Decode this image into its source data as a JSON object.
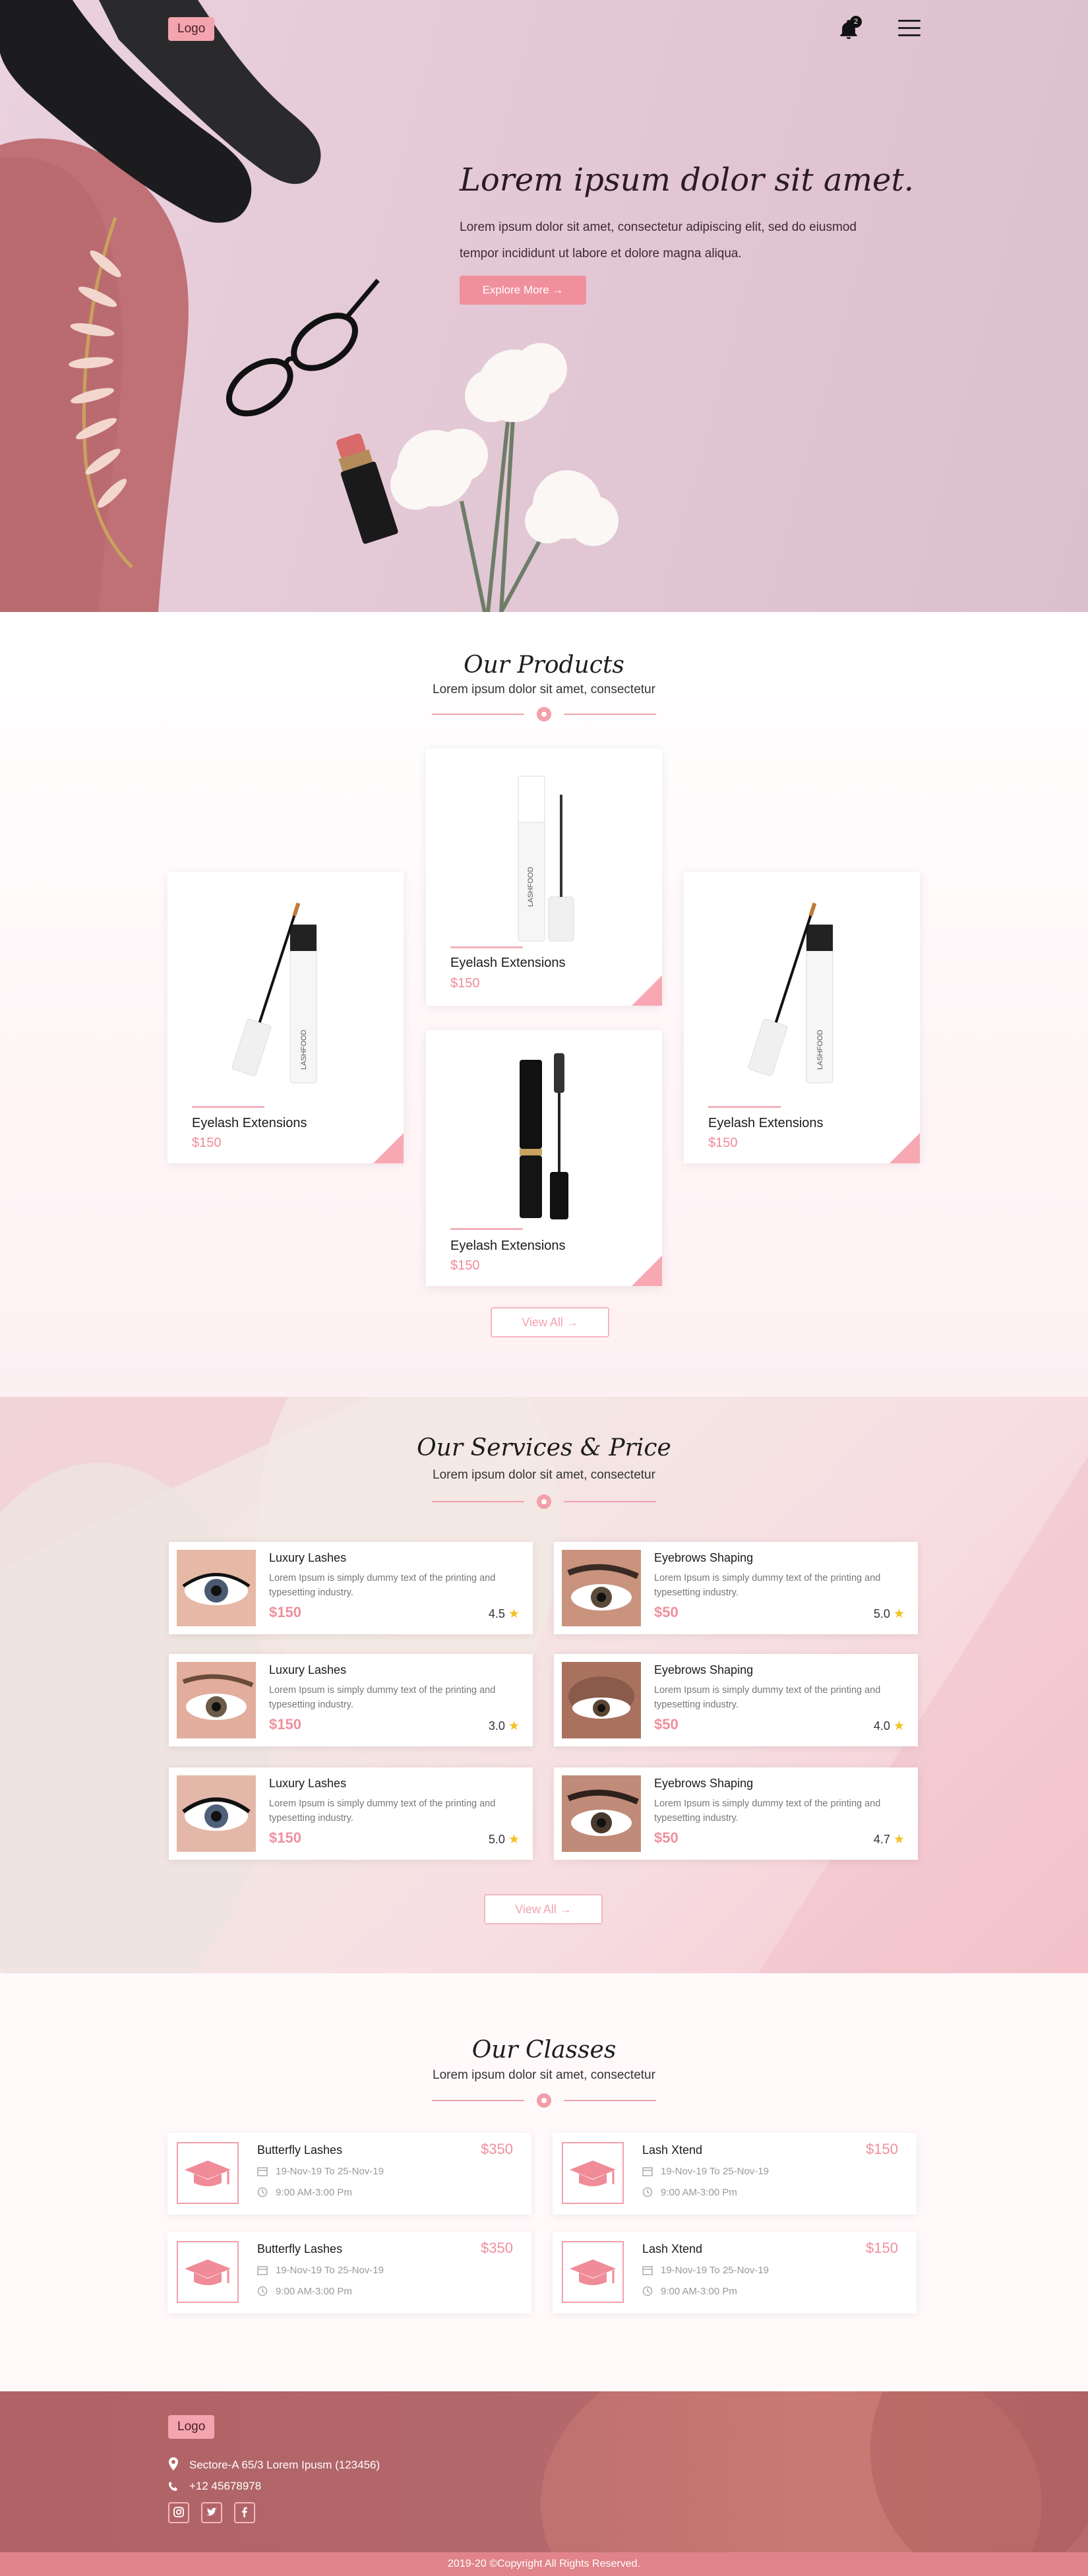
{
  "header": {
    "logo": "Logo",
    "notification_count": "2"
  },
  "hero": {
    "title": "Lorem ipsum dolor sit amet.",
    "text": "Lorem ipsum dolor sit amet, consectetur adipiscing elit, sed do eiusmod tempor incididunt ut labore et dolore magna aliqua.",
    "button": "Explore More →"
  },
  "products": {
    "title": "Our Products",
    "subtitle": "Lorem ipsum dolor sit amet, consectetur",
    "items": [
      {
        "name": "Eyelash Extensions",
        "price": "$150"
      },
      {
        "name": "Eyelash Extensions",
        "price": "$150"
      },
      {
        "name": "Eyelash Extensions",
        "price": "$150"
      },
      {
        "name": "Eyelash Extensions",
        "price": "$150"
      }
    ],
    "view_all": "View All →"
  },
  "services": {
    "title": "Our Services & Price",
    "subtitle": "Lorem ipsum dolor sit amet, consectetur",
    "items": [
      {
        "title": "Luxury Lashes",
        "desc": "Lorem Ipsum is simply dummy text of the printing and typesetting industry.",
        "price": "$150",
        "rating": "4.5"
      },
      {
        "title": "Eyebrows Shaping",
        "desc": "Lorem Ipsum is simply dummy text of the printing and typesetting industry.",
        "price": "$50",
        "rating": "5.0"
      },
      {
        "title": "Luxury Lashes",
        "desc": "Lorem Ipsum is simply dummy text of the printing and typesetting industry.",
        "price": "$150",
        "rating": "3.0"
      },
      {
        "title": "Eyebrows Shaping",
        "desc": "Lorem Ipsum is simply dummy text of the printing and typesetting industry.",
        "price": "$50",
        "rating": "4.0"
      },
      {
        "title": "Luxury Lashes",
        "desc": "Lorem Ipsum is simply dummy text of the printing and typesetting industry.",
        "price": "$150",
        "rating": "5.0"
      },
      {
        "title": "Eyebrows Shaping",
        "desc": "Lorem Ipsum is simply dummy text of the printing and typesetting industry.",
        "price": "$50",
        "rating": "4.7"
      }
    ],
    "view_all": "View All →"
  },
  "classes": {
    "title": "Our Classes",
    "subtitle": "Lorem ipsum dolor sit amet, consectetur",
    "items": [
      {
        "name": "Butterfly Lashes",
        "price": "$350",
        "dates": "19-Nov-19 To 25-Nov-19",
        "time": "9:00 AM-3:00 Pm"
      },
      {
        "name": "Lash Xtend",
        "price": "$150",
        "dates": "19-Nov-19 To 25-Nov-19",
        "time": "9:00 AM-3:00 Pm"
      },
      {
        "name": "Butterfly Lashes",
        "price": "$350",
        "dates": "19-Nov-19 To 25-Nov-19",
        "time": "9:00 AM-3:00 Pm"
      },
      {
        "name": "Lash Xtend",
        "price": "$150",
        "dates": "19-Nov-19 To 25-Nov-19",
        "time": "9:00 AM-3:00 Pm"
      }
    ]
  },
  "footer": {
    "logo": "Logo",
    "address": "Sectore-A 65/3 Lorem Ipusm (123456)",
    "phone": "+12 45678978",
    "social": [
      "instagram-icon",
      "twitter-icon",
      "facebook-icon"
    ],
    "copyright": "2019-20 ©Copyright All Rights Reserved."
  },
  "colors": {
    "accent": "#f0909d",
    "accent_light": "#f4b2bb",
    "footer": "#b06266",
    "copyright_bar": "#e0848a",
    "star": "#f3c020"
  }
}
